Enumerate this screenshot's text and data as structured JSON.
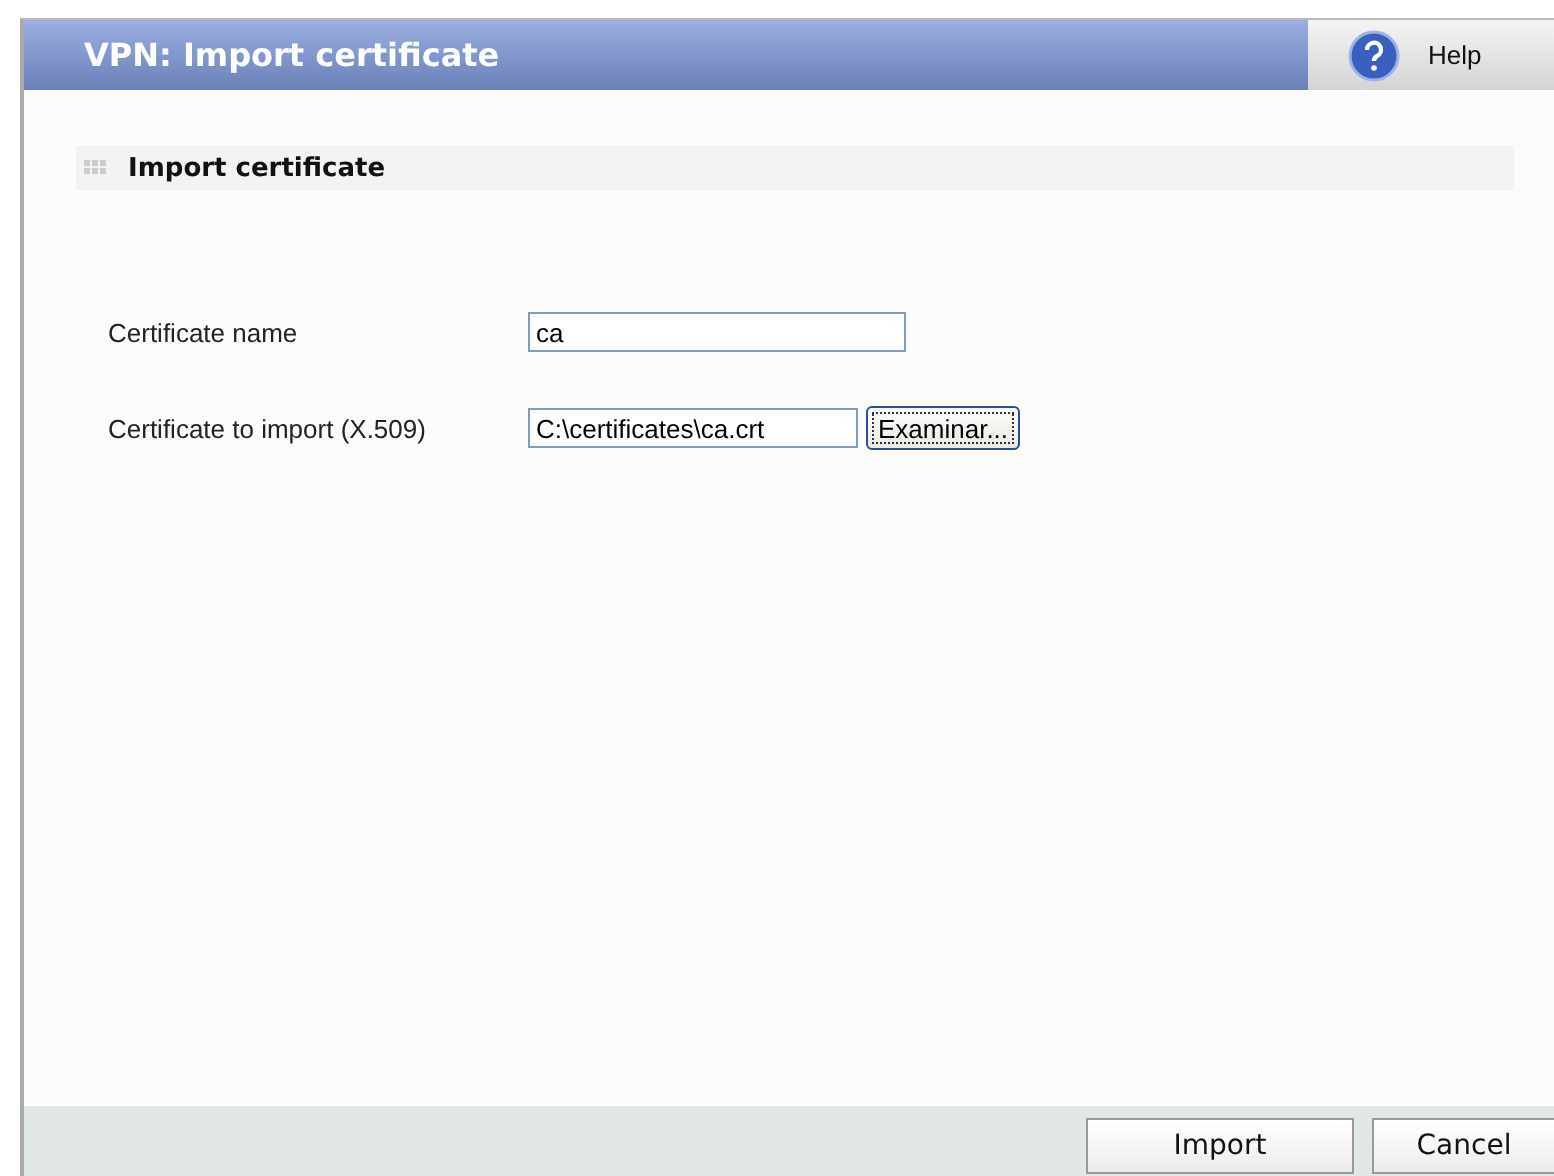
{
  "window": {
    "title": "VPN: Import certificate"
  },
  "help": {
    "label": "Help"
  },
  "section": {
    "title": "Import certificate"
  },
  "fields": [
    {
      "kind": "text",
      "label": "Certificate name",
      "value": "ca"
    },
    {
      "kind": "file",
      "label": "Certificate to import (X.509)",
      "value": "C:\\certificates\\ca.crt",
      "button": "Examinar..."
    }
  ],
  "buttons": [
    "Import",
    "Cancel"
  ]
}
